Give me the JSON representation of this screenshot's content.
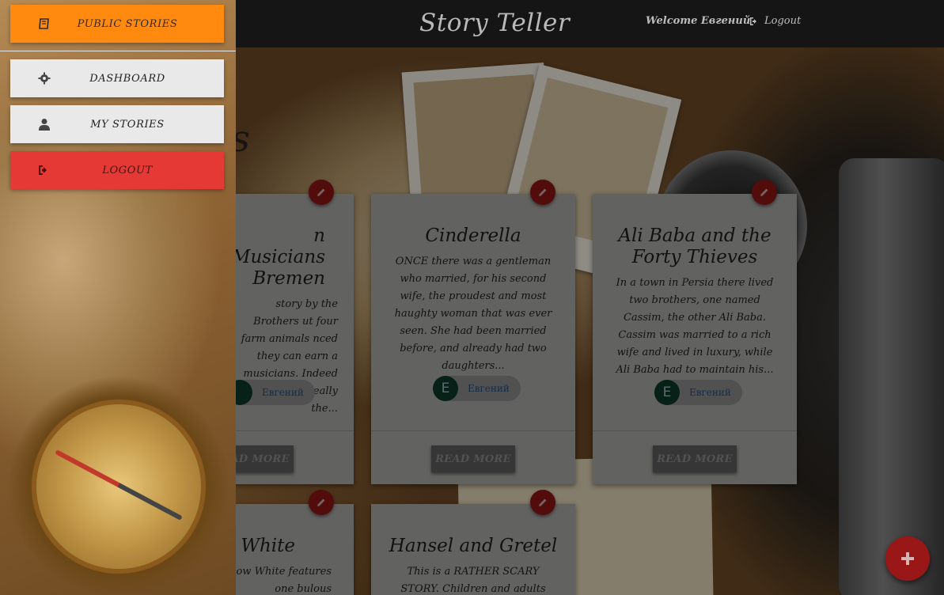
{
  "app": {
    "brand": "Story Teller",
    "welcome": "Welcome Евгений",
    "logout_label": "Logout"
  },
  "page": {
    "title_fragment": "es"
  },
  "sidenav": {
    "items": [
      {
        "label": "PUBLIC STORIES",
        "icon": "book-icon"
      },
      {
        "label": "DASHBOARD",
        "icon": "gear-icon"
      },
      {
        "label": "MY STORIES",
        "icon": "user-icon"
      },
      {
        "label": "LOGOUT",
        "icon": "sign-out-icon"
      }
    ]
  },
  "stories": [
    {
      "title": "n Musicians Bremen",
      "excerpt": "story by the Brothers ut four farm animals nced they can earn a musicians. Indeed they isn't really the...",
      "author_initial": "",
      "author": "Евгений",
      "read_more": "READ MORE"
    },
    {
      "title": "Cinderella",
      "excerpt": "ONCE there was a gentleman who married, for his second wife, the proudest and most haughty woman that was ever seen. She had been married before, and already had two daughters...",
      "author_initial": "E",
      "author": "Евгений",
      "read_more": "READ MORE"
    },
    {
      "title": "Ali Baba and the Forty Thieves",
      "excerpt": "In a town in Persia there lived two brothers, one named Cassim, the other Ali Baba. Cassim was married to a rich wife and lived in luxury, while Ali Baba had to maintain his...",
      "author_initial": "E",
      "author": "Евгений",
      "read_more": "READ MORE"
    },
    {
      "title": "w White",
      "excerpt": "ow White features one bulous baddies of all"
    },
    {
      "title": "Hansel and Gretel",
      "excerpt": "This is a RATHER SCARY STORY. Children and adults might be a touch"
    }
  ],
  "colors": {
    "navbar": "#151515",
    "public_stories_button": "#ff8a0f",
    "logout_button": "#e53935",
    "fab": "#9a1717"
  }
}
